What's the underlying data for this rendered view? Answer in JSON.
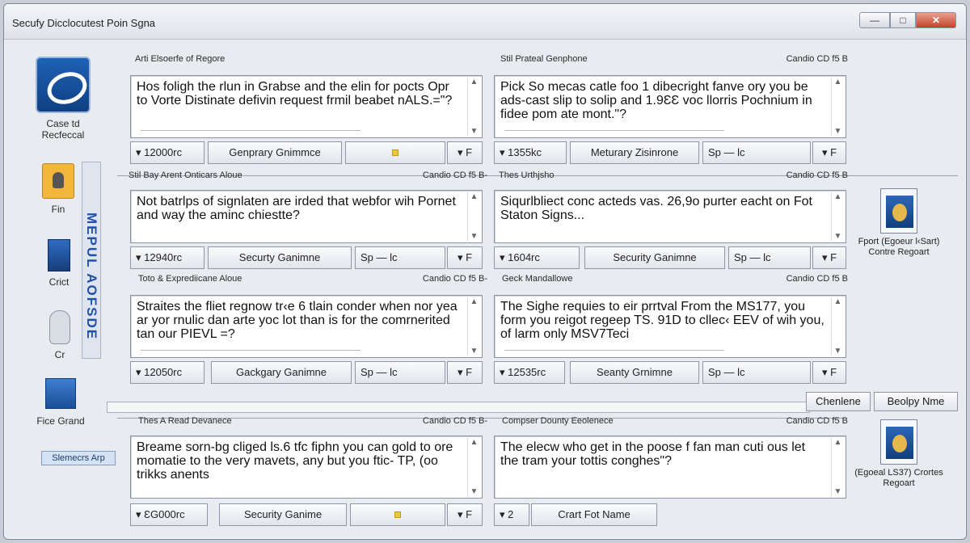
{
  "window": {
    "title": "Secufy Dicclocutest Poin Sgna",
    "controls": {
      "minimize": "—",
      "maximize": "□",
      "close": "✕"
    }
  },
  "sidebar": {
    "items": [
      {
        "label": "Case td Recfeccal",
        "icon": "logo-icon"
      },
      {
        "label": "Fin",
        "icon": "lock-icon"
      },
      {
        "label": "Crict",
        "icon": "document-icon"
      },
      {
        "label": "Cr",
        "icon": "hand-icon"
      },
      {
        "label": "Fice Grand",
        "icon": "chart-icon"
      }
    ],
    "button": "Slemecrs Arp",
    "vertical_tab": "MEPUL AOFSDE"
  },
  "groups": [
    {
      "name": "Arti Elsoerfe of Regore",
      "code": "",
      "text": "Hos foligh the rlun in Grabse and the elin for pocts Opr to Vorte Distinate defivin request frmil beabet nALS.=\"?",
      "value": "▾ 12000rc",
      "button": "Genprary Gnimmce",
      "third": "",
      "fourth": "▾  F",
      "yellow": true
    },
    {
      "name": "Stil Prateal Genphone",
      "code": "Candio  CD f5  B",
      "text": "Pick So mecas catle foo 1 dibecright fanve ory you be ads-cast slip to solip and 1.9ƐƐ voc llorris Pochnium in fidee pom ate mont.\"?",
      "value": "▾ 1355kc",
      "button": "Meturary Zisinrone",
      "third": "Sp — lc",
      "fourth": "▾  F",
      "yellow": false
    },
    {
      "name": "Stil Bay Arent Onticars Aloue",
      "code": "Candio  CD f5  B-",
      "text": "Not batrlps of signlaten are irded that webfor wih Pornet and way the aminc chiestte?",
      "value": "▾ 12940rc",
      "button": "Securty Ganimne",
      "third": "Sp — lc",
      "fourth": "▾  F",
      "yellow": false
    },
    {
      "name": "Thes Urthjsho",
      "code": "Candio  CD f5  B",
      "text": "Siqurlbliect conc acteds vas. 26,9o purter eacht on Fot Staton Signs...",
      "value": "▾ 1604rc",
      "button": "Security Ganimne",
      "third": "Sp — lc",
      "fourth": "▾  F",
      "yellow": false
    },
    {
      "name": "Toto & Exprediicane Aloue",
      "code": "Candio  CD f5  B-",
      "text": "Straites the fliet regnow tr‹e 6 tlain conder when nor yea ar yor rnulic dan arte yoc lot than is for the comrnerited tan our PIEVL =?",
      "value": "▾ 12050rc",
      "button": "Gackgary Ganimne",
      "third": "Sp — lc",
      "fourth": "▾  F",
      "yellow": false
    },
    {
      "name": "Geck Mandallowe",
      "code": "Candio  CD f5  B",
      "text": "The Sighe requies to eir prrtval From the MS177, you form you reigot regeep TS. 91D to cllec‹ EEV of wih you, of larm only MSV7Teci",
      "value": "▾ 12535rc",
      "button": "Seanty Grnimne",
      "third": "Sp — lc",
      "fourth": "▾  F",
      "yellow": false
    },
    {
      "name": "Thes A Read Devanece",
      "code": "Candio  CD f5  B-",
      "text": "Breame sorn-bg cliged ls.6 tfc fiphn you can gold to ore momatie to the very mavets, any but you ftic- TP, (oo trikks anents",
      "value": "▾ ƐG000rc",
      "button": "Security Ganime",
      "third": "",
      "fourth": "▾  F",
      "yellow": true
    },
    {
      "name": "Compser Dounty Eeolenece",
      "code": "Candio  CD f5  B",
      "text": "The elecw who get in the poose f fan man cuti ous let the tram your tottis conghes\"?",
      "value": "▾ 2",
      "button": "Crart Fot Name",
      "third": "",
      "fourth": "",
      "yellow": false
    }
  ],
  "action_buttons": {
    "left": "Chenlene",
    "right": "Beolpy Nme"
  },
  "reports": [
    {
      "label": "Fport (Egoeur l‹Sart) Contre Regoart",
      "icon": "report-icon"
    },
    {
      "label": "(Egoeal LS37) Crortes Regoart",
      "icon": "report-icon"
    }
  ]
}
